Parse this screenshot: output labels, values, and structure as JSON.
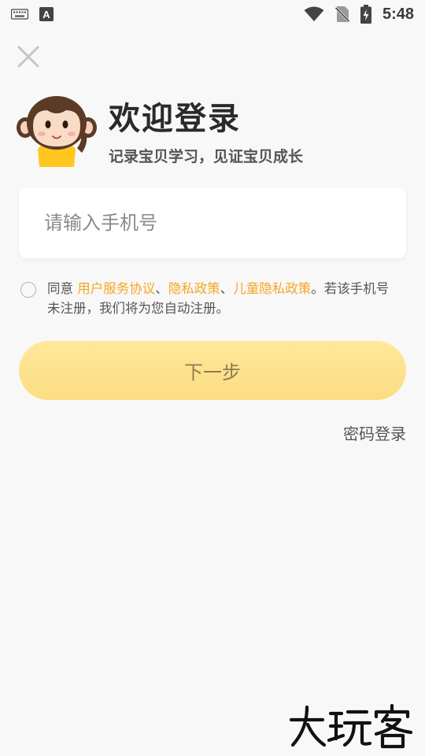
{
  "status_bar": {
    "time": "5:48",
    "icons": [
      "keyboard-icon",
      "a-letter-icon",
      "wifi-icon",
      "no-sim-icon",
      "battery-charging-icon"
    ],
    "a_glyph": "A"
  },
  "header": {
    "close_icon": "close-icon",
    "mascot_icon": "monkey-mascot-icon",
    "title": "欢迎登录",
    "subtitle": "记录宝贝学习，见证宝贝成长"
  },
  "phone_field": {
    "value": "",
    "placeholder": "请输入手机号"
  },
  "agreement": {
    "prefix": "同意 ",
    "links": [
      "用户服务协议",
      "隐私政策",
      "儿童隐私政策"
    ],
    "separator": "、",
    "suffix": "。若该手机号未注册，我们将为您自动注册。"
  },
  "next_button": {
    "label": "下一步"
  },
  "password_login": {
    "label": "密码登录"
  },
  "watermark": {
    "text": "大玩客"
  },
  "colors": {
    "accent": "#f5a623",
    "button_bg": "#fce38f",
    "button_text": "#8f7a4e",
    "background": "#f8f8f8"
  }
}
